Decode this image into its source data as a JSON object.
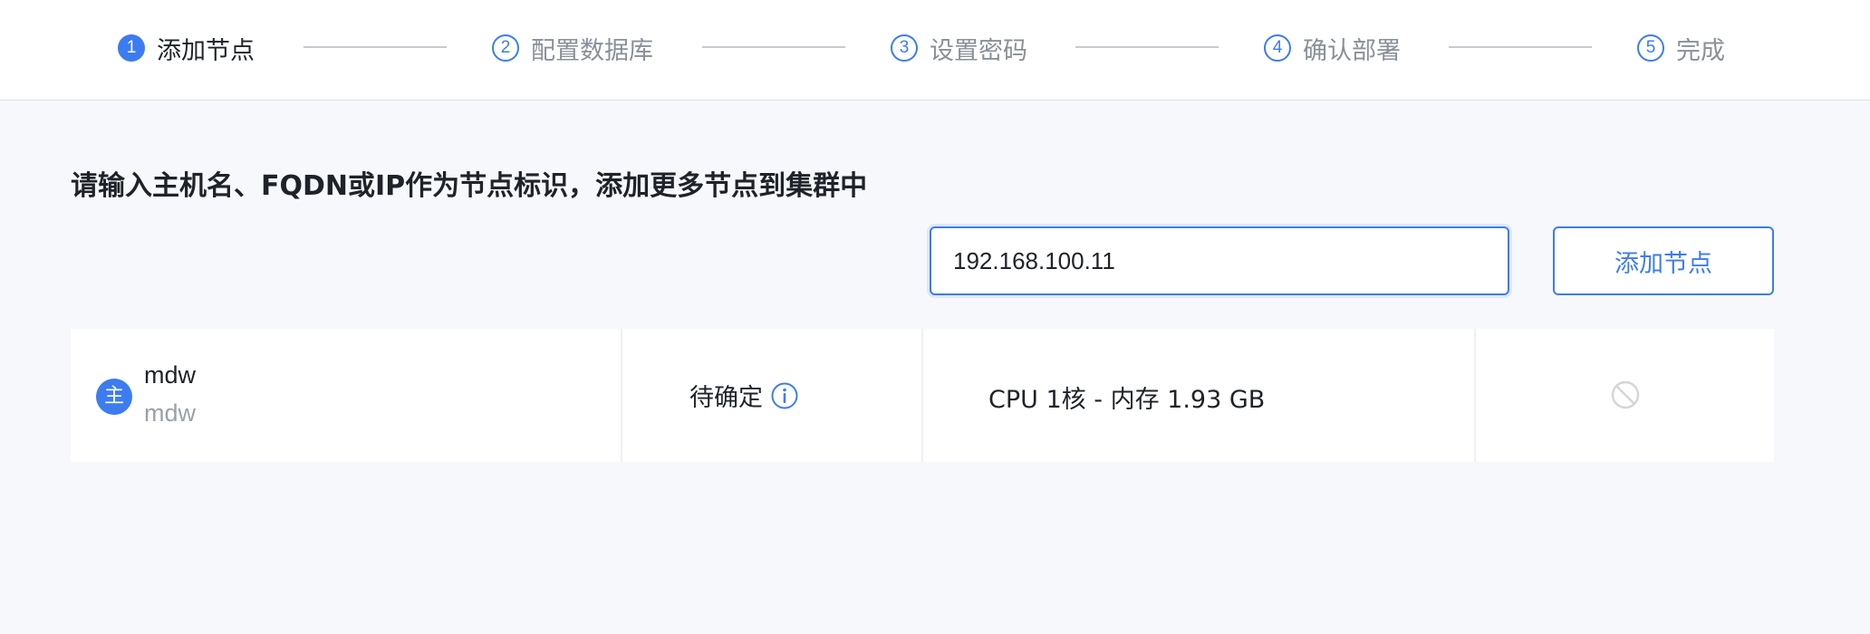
{
  "stepper": {
    "steps": [
      {
        "num": "1",
        "label": "添加节点"
      },
      {
        "num": "2",
        "label": "配置数据库"
      },
      {
        "num": "3",
        "label": "设置密码"
      },
      {
        "num": "4",
        "label": "确认部署"
      },
      {
        "num": "5",
        "label": "完成"
      }
    ],
    "active_step": 1
  },
  "main": {
    "instruction": "请输入主机名、FQDN或IP作为节点标识，添加更多节点到集群中",
    "host_input_value": "192.168.100.11",
    "add_button_label": "添加节点"
  },
  "nodes": [
    {
      "role_badge": "主",
      "hostname": "mdw",
      "hostname_sub": "mdw",
      "status": "待确定",
      "status_icon": "info-icon",
      "spec": "CPU 1核 - 内存 1.93 GB",
      "action_icon": "ban-icon"
    }
  ],
  "colors": {
    "accent": "#3d7cf0",
    "muted_text": "#8a9099",
    "background": "#f7f8fc",
    "disabled_icon": "#d4d6da"
  }
}
